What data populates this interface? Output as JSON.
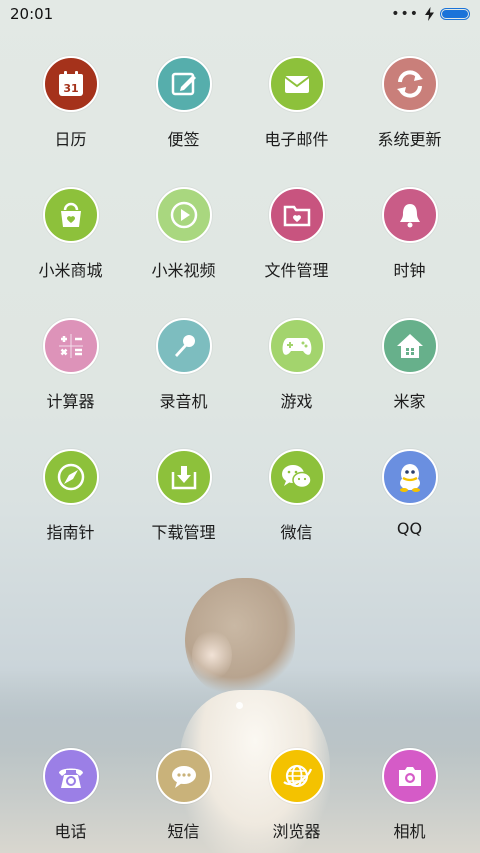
{
  "status": {
    "time": "20:01"
  },
  "apps": [
    {
      "label": "日历",
      "icon": "calendar-icon",
      "color": "#a5321b",
      "badge": "31"
    },
    {
      "label": "便签",
      "icon": "notes-icon",
      "color": "#56aeac"
    },
    {
      "label": "电子邮件",
      "icon": "mail-icon",
      "color": "#8dc13b"
    },
    {
      "label": "系统更新",
      "icon": "update-icon",
      "color": "#c97f7a"
    },
    {
      "label": "小米商城",
      "icon": "shop-bag-icon",
      "color": "#8dc13b"
    },
    {
      "label": "小米视频",
      "icon": "video-play-icon",
      "color": "#a9d77f"
    },
    {
      "label": "文件管理",
      "icon": "folder-icon",
      "color": "#c8547f"
    },
    {
      "label": "时钟",
      "icon": "bell-icon",
      "color": "#c95c87"
    },
    {
      "label": "计算器",
      "icon": "calculator-icon",
      "color": "#dd93b9"
    },
    {
      "label": "录音机",
      "icon": "microphone-icon",
      "color": "#7dbdbf"
    },
    {
      "label": "游戏",
      "icon": "gamepad-icon",
      "color": "#a3d46d"
    },
    {
      "label": "米家",
      "icon": "home-icon",
      "color": "#67b08b"
    },
    {
      "label": "指南针",
      "icon": "compass-icon",
      "color": "#8dc13b"
    },
    {
      "label": "下载管理",
      "icon": "download-icon",
      "color": "#8dc13b"
    },
    {
      "label": "微信",
      "icon": "wechat-icon",
      "color": "#8dc13b"
    },
    {
      "label": "QQ",
      "icon": "qq-icon",
      "color": "#6a8fe0"
    }
  ],
  "dock": [
    {
      "label": "电话",
      "icon": "phone-icon",
      "color": "#9b7fe6"
    },
    {
      "label": "短信",
      "icon": "message-icon",
      "color": "#c9b27a"
    },
    {
      "label": "浏览器",
      "icon": "browser-globe-icon",
      "color": "#f4c200"
    },
    {
      "label": "相机",
      "icon": "camera-icon",
      "color": "#d55bc7"
    }
  ]
}
